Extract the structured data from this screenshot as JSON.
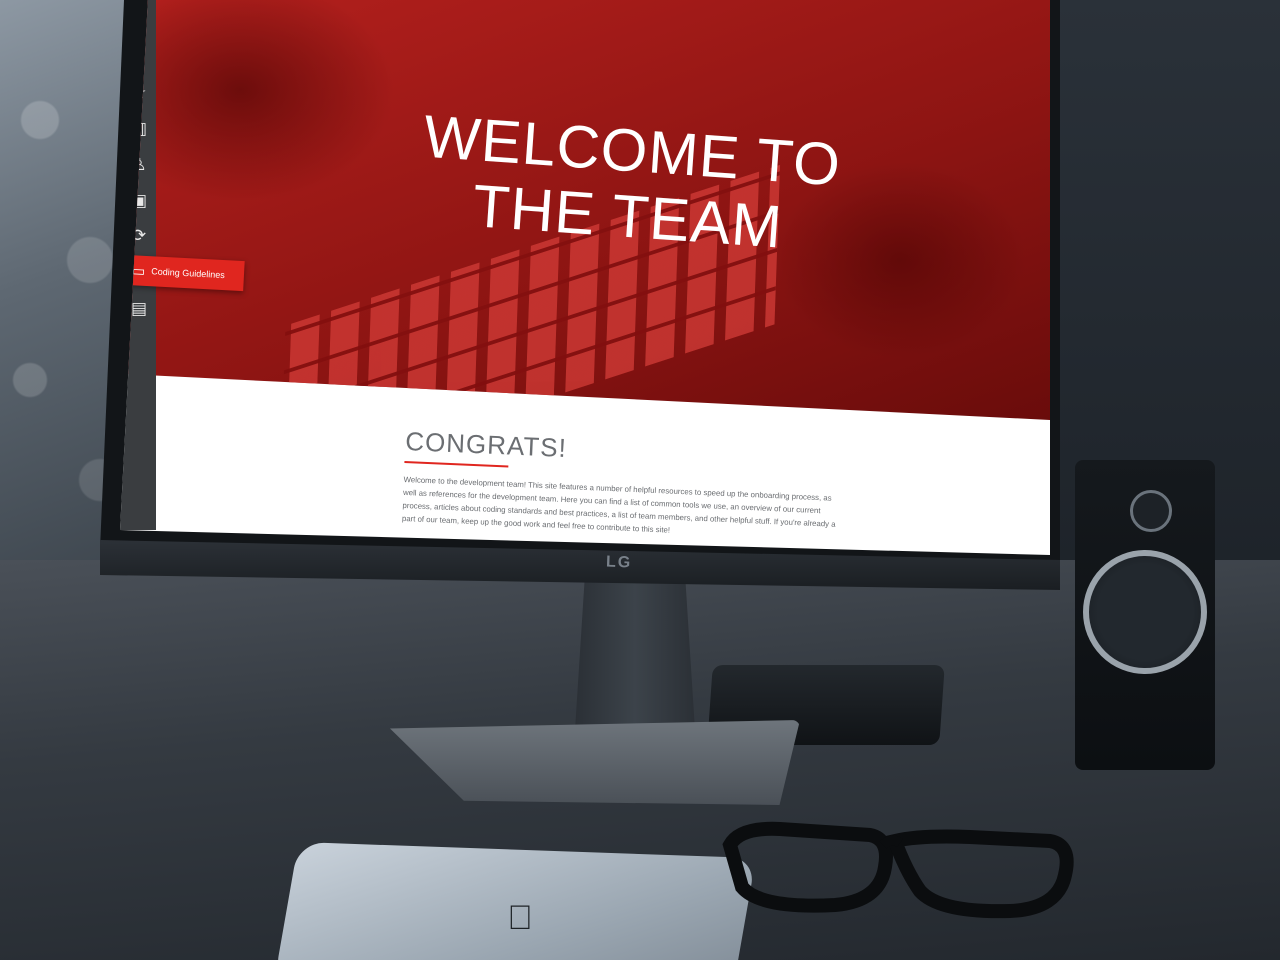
{
  "sidebar": {
    "items": [
      {
        "icon": "star-icon",
        "glyph": "☆"
      },
      {
        "icon": "map-icon",
        "glyph": "▥"
      },
      {
        "icon": "user-icon",
        "glyph": "♙"
      },
      {
        "icon": "briefcase-icon",
        "glyph": "▣"
      },
      {
        "icon": "refresh-icon",
        "glyph": "⟳"
      },
      {
        "icon": "monitor-icon",
        "glyph": "▭",
        "label": "Coding Guidelines",
        "active": true
      },
      {
        "icon": "document-icon",
        "glyph": "▤"
      }
    ]
  },
  "hero": {
    "title": "WELCOME TO THE TEAM"
  },
  "content": {
    "heading": "CONGRATS!",
    "body": "Welcome to the development team! This site features a number of helpful resources to speed up the onboarding process, as well as references for the development team. Here you can find a list of common tools we use, an overview of our current process, articles about coding standards and best practices, a list of team members, and other helpful stuff. If you're already a part of our team, keep up the good work and feel free to contribute to this site!"
  },
  "device": {
    "brand": "LG"
  },
  "colors": {
    "accent": "#e0261f",
    "hero": "#9b1a17",
    "sidebar": "#3a3d40"
  }
}
